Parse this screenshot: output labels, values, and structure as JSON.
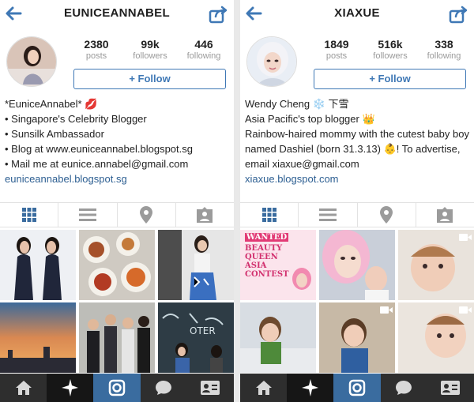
{
  "left": {
    "username": "EUNICEANNABEL",
    "stats": [
      {
        "value": "2380",
        "label": "posts"
      },
      {
        "value": "99k",
        "label": "followers"
      },
      {
        "value": "446",
        "label": "following"
      }
    ],
    "follow_label": "+ Follow",
    "bio": [
      "*EuniceAnnabel* 💋",
      "• Singapore's Celebrity Blogger",
      "• Sunsilk Ambassador",
      "• Blog at www.euniceannabel.blogspot.sg",
      "• Mail me at eunice.annabel@gmail.com"
    ],
    "link": "euniceannabel.blogspot.sg"
  },
  "right": {
    "username": "XIAXUE",
    "stats": [
      {
        "value": "1849",
        "label": "posts"
      },
      {
        "value": "516k",
        "label": "followers"
      },
      {
        "value": "338",
        "label": "following"
      }
    ],
    "follow_label": "+ Follow",
    "bio": [
      "Wendy Cheng ❄️ 下雪",
      "Asia Pacific's top blogger 👑",
      "Rainbow-haired mommy with the cutest baby boy named Dashiel (born 31.3.13) 👶! To advertise, email xiaxue@gmail.com"
    ],
    "link": "xiaxue.blogspot.com",
    "poster": {
      "wanted": "WANTED",
      "title": "BEAUTY QUEEN ASIA CONTEST"
    }
  },
  "icons": {
    "tabs": [
      "grid-icon",
      "list-icon",
      "location-pin-icon",
      "tagged-photos-icon"
    ],
    "bottom": [
      "home-icon",
      "explore-icon",
      "camera-icon",
      "activity-icon",
      "profile-icon"
    ]
  },
  "colors": {
    "accent": "#3f78b5",
    "link": "#2d5f92",
    "bottombar": "#2e2e2e",
    "bottom_active": "#3a6c9f"
  }
}
